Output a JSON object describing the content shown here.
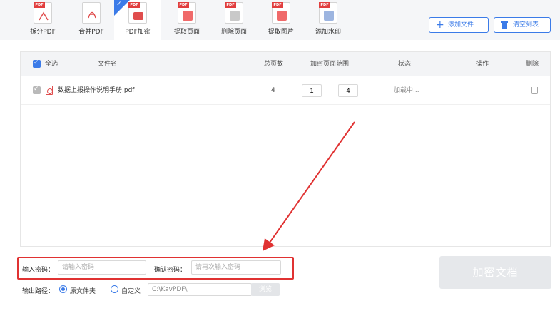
{
  "toolbar": {
    "tools": [
      {
        "label": "拆分PDF",
        "icon": "split-pdf-icon"
      },
      {
        "label": "合并PDF",
        "icon": "merge-pdf-icon"
      },
      {
        "label": "PDF加密",
        "icon": "encrypt-pdf-icon"
      },
      {
        "label": "提取页面",
        "icon": "extract-pages-icon"
      },
      {
        "label": "删除页面",
        "icon": "delete-pages-icon"
      },
      {
        "label": "提取图片",
        "icon": "extract-images-icon"
      },
      {
        "label": "添加水印",
        "icon": "watermark-icon"
      }
    ],
    "icon_tag": "PDF",
    "add_file": "添加文件",
    "clear_list": "清空列表",
    "accent": "#3b7be8"
  },
  "table": {
    "select_all": "全选",
    "col_filename": "文件名",
    "col_pages": "总页数",
    "col_range": "加密页面范围",
    "col_status": "状态",
    "col_action": "操作",
    "col_delete": "删除",
    "rows": [
      {
        "filename": "数据上报操作说明手册.pdf",
        "pages": "4",
        "range_from": "1",
        "range_to": "4",
        "status": "加载中..."
      }
    ]
  },
  "form": {
    "password_label": "输入密码：",
    "password_placeholder": "请输入密码",
    "confirm_label": "确认密码：",
    "confirm_placeholder": "请再次输入密码",
    "output_label": "输出路径：",
    "option_original": "原文件夹",
    "option_custom": "自定义",
    "path_value": "C:\\KavPDF\\",
    "browse": "浏览",
    "encrypt_button": "加密文档"
  },
  "colors": {
    "highlight_box": "#e03232",
    "arrow": "#e03232"
  }
}
